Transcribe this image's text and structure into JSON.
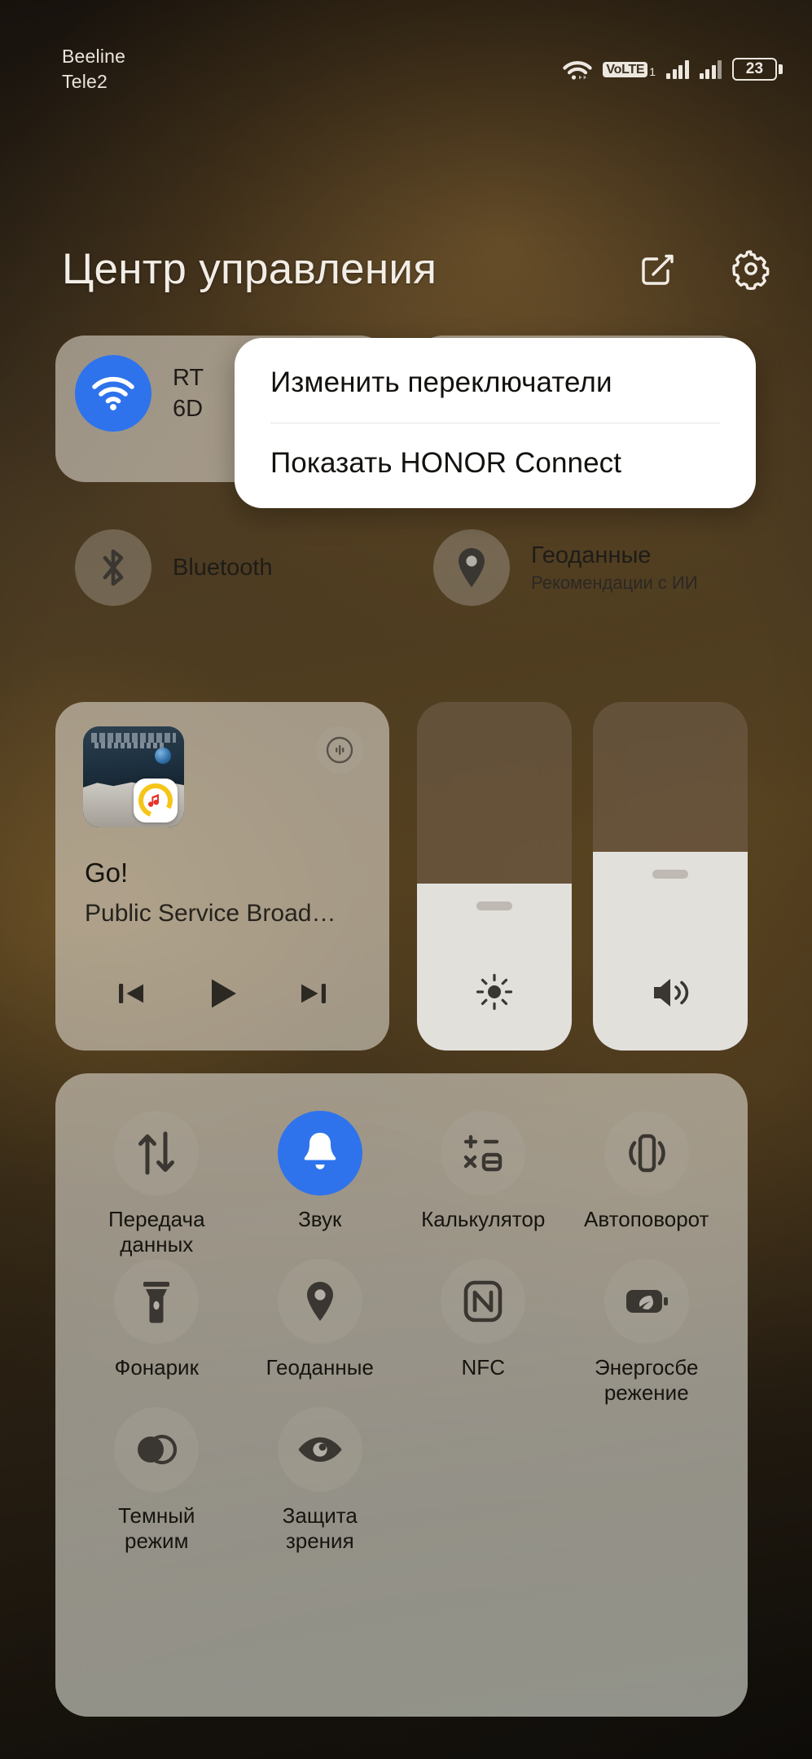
{
  "status_bar": {
    "carrier_1": "Beeline",
    "carrier_2": "Tele2",
    "volte_label": "VoLTE",
    "volte_sim": "1",
    "battery_percent": "23",
    "icons": [
      "wifi-icon",
      "volte-badge",
      "signal-bars-sim1",
      "signal-bars-sim2",
      "battery-icon"
    ]
  },
  "header": {
    "title": "Центр управления",
    "edit_icon": "edit-square-icon",
    "settings_icon": "gear-icon"
  },
  "popup_menu": {
    "items": [
      {
        "label": "Изменить переключатели"
      },
      {
        "label": "Показать HONOR Connect"
      }
    ]
  },
  "connectivity": {
    "wifi": {
      "label": "RT",
      "sub": "6D",
      "state": "on",
      "icon": "wifi-icon",
      "accent": "#2e73ec"
    },
    "bluetooth": {
      "label": "Bluetooth",
      "state": "off",
      "icon": "bluetooth-icon"
    },
    "location": {
      "label": "Геоданные",
      "sub": "Рекомендации с ИИ",
      "state": "off",
      "icon": "location-pin-icon"
    }
  },
  "media": {
    "track_title": "Go!",
    "artist": "Public Service Broad…",
    "cast_icon": "cast-audio-icon",
    "app_badge_icon": "music-note-icon",
    "controls": {
      "previous": "skip-previous-icon",
      "play": "play-icon",
      "next": "skip-next-icon"
    }
  },
  "sliders": [
    {
      "name": "brightness",
      "icon": "brightness-icon",
      "value_percent": 48
    },
    {
      "name": "volume",
      "icon": "volume-icon",
      "value_percent": 57
    }
  ],
  "quick_toggles": [
    {
      "label": "Передача данных",
      "icon": "data-transfer-icon",
      "state": "off"
    },
    {
      "label": "Звук",
      "icon": "bell-icon",
      "state": "on"
    },
    {
      "label": "Калькулятор",
      "icon": "calculator-icon",
      "state": "off"
    },
    {
      "label": "Автоповорот",
      "icon": "auto-rotate-icon",
      "state": "off"
    },
    {
      "label": "Фонарик",
      "icon": "flashlight-icon",
      "state": "off"
    },
    {
      "label": "Геоданные",
      "icon": "location-pin-icon",
      "state": "off"
    },
    {
      "label": "NFC",
      "icon": "nfc-icon",
      "state": "off"
    },
    {
      "label": "Энергосбе режение",
      "icon": "battery-saver-icon",
      "state": "off"
    },
    {
      "label": "Темный режим",
      "icon": "dark-mode-icon",
      "state": "off"
    },
    {
      "label": "Защита зрения",
      "icon": "eye-comfort-icon",
      "state": "off"
    }
  ],
  "colors": {
    "accent": "#2e73ec",
    "panel": "#e2dcd2",
    "text_dark": "#16140f",
    "text_light": "#f2ede6"
  }
}
